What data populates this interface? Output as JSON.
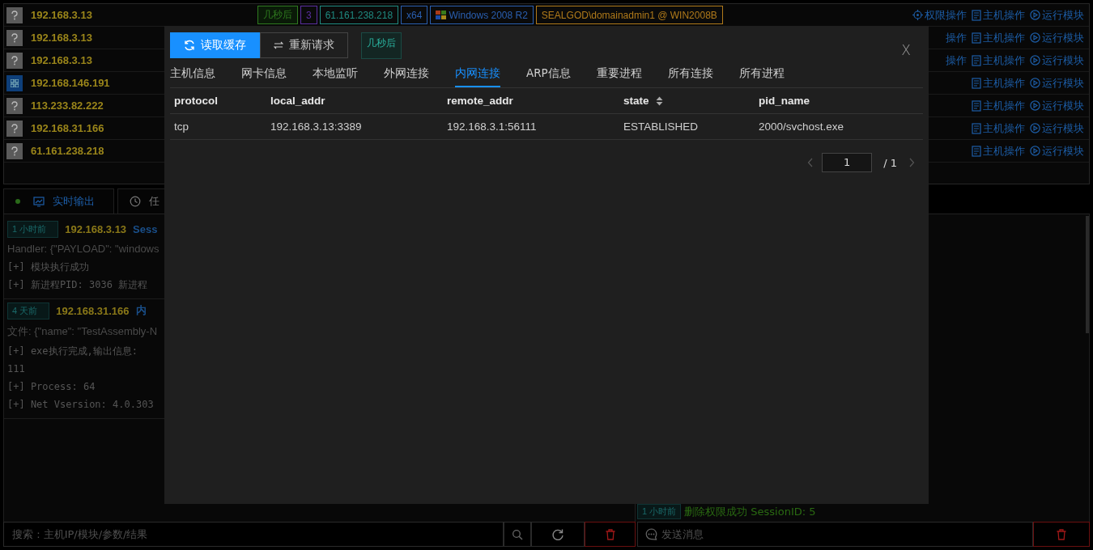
{
  "hosts": [
    {
      "kind": "unknown",
      "ip": "192.168.3.13",
      "tags": [
        {
          "text": "几秒后",
          "color": "#2f7a1f",
          "kind": "plain"
        },
        {
          "text": "3",
          "color": "#5a2fa0",
          "kind": "plain"
        },
        {
          "text": "61.161.238.218",
          "color": "#1f8a80",
          "kind": "plain"
        },
        {
          "text": "x64",
          "color": "#2a5fb0",
          "kind": "plain"
        },
        {
          "text": "Windows 2008 R2",
          "color": "#2a5fb0",
          "kind": "os"
        },
        {
          "text": "SEALGOD\\domainadmin1 @ WIN2008B",
          "color": "#b07a1a",
          "kind": "plain"
        }
      ],
      "actions": [
        {
          "kind": "target",
          "label": "权限操作"
        },
        {
          "kind": "doc",
          "label": "主机操作"
        },
        {
          "kind": "play",
          "label": "运行模块"
        }
      ]
    },
    {
      "kind": "unknown",
      "ip": "192.168.3.13",
      "actions": [
        {
          "kind": "text",
          "label": "操作"
        },
        {
          "kind": "doc",
          "label": "主机操作"
        },
        {
          "kind": "play",
          "label": "运行模块"
        }
      ]
    },
    {
      "kind": "unknown",
      "ip": "192.168.3.13",
      "actions": [
        {
          "kind": "text",
          "label": "操作"
        },
        {
          "kind": "doc",
          "label": "主机操作"
        },
        {
          "kind": "play",
          "label": "运行模块"
        }
      ]
    },
    {
      "kind": "windows",
      "ip": "192.168.146.191",
      "actions": [
        {
          "kind": "doc",
          "label": "主机操作"
        },
        {
          "kind": "play",
          "label": "运行模块"
        }
      ]
    },
    {
      "kind": "unknown",
      "ip": "113.233.82.222",
      "actions": [
        {
          "kind": "doc",
          "label": "主机操作"
        },
        {
          "kind": "play",
          "label": "运行模块"
        }
      ]
    },
    {
      "kind": "unknown",
      "ip": "192.168.31.166",
      "actions": [
        {
          "kind": "doc",
          "label": "主机操作"
        },
        {
          "kind": "play",
          "label": "运行模块"
        }
      ]
    },
    {
      "kind": "unknown",
      "ip": "61.161.238.218",
      "actions": [
        {
          "kind": "doc",
          "label": "主机操作"
        },
        {
          "kind": "play",
          "label": "运行模块"
        }
      ]
    }
  ],
  "output_panel": {
    "tabs": [
      {
        "label": "实时输出",
        "kind": "monitor",
        "selected": true
      },
      {
        "label": "任",
        "kind": "clock",
        "selected": false
      }
    ],
    "log": [
      {
        "time": "1 小时前",
        "ip": "192.168.3.13",
        "title": "Sess",
        "detail": "Handler: {\"PAYLOAD\": \"windows",
        "lines": [
          "[+] 模块执行成功",
          "[+] 新进程PID: 3036 新进程"
        ]
      },
      {
        "time": "4 天前",
        "ip": "192.168.31.166",
        "title": "内",
        "detail": "文件: {\"name\": \"TestAssembly-N",
        "lines": [
          "[+] exe执行完成,输出信息:",
          "111",
          "[+] Process: 64",
          "[+] Net Vsersion: 4.0.303"
        ]
      }
    ],
    "messages": [
      {
        "time": "1 小时前",
        "text": "删除权限成功 SessionID: 5"
      }
    ],
    "search": {
      "placeholder": "搜索 : 主机IP/模块/参数/结果"
    },
    "message_input": {
      "placeholder": "发送消息"
    }
  },
  "dialog": {
    "buttons": [
      {
        "label": "读取缓存",
        "kind": "sync",
        "selected": true
      },
      {
        "label": "重新请求",
        "kind": "swap",
        "selected": false
      }
    ],
    "badge": "几秒后",
    "close": "X",
    "tabs": [
      {
        "label": "主机信息",
        "selected": false
      },
      {
        "label": "网卡信息",
        "selected": false
      },
      {
        "label": "本地监听",
        "selected": false
      },
      {
        "label": "外网连接",
        "selected": false
      },
      {
        "label": "内网连接",
        "selected": true
      },
      {
        "label": "ARP信息",
        "selected": false
      },
      {
        "label": "重要进程",
        "selected": false
      },
      {
        "label": "所有连接",
        "selected": false
      },
      {
        "label": "所有进程",
        "selected": false
      }
    ],
    "table": {
      "columns": [
        {
          "label": "protocol",
          "sortable": false
        },
        {
          "label": "local_addr",
          "sortable": false
        },
        {
          "label": "remote_addr",
          "sortable": false
        },
        {
          "label": "state",
          "sortable": true
        },
        {
          "label": "pid_name",
          "sortable": false
        }
      ],
      "rows": [
        [
          "tcp",
          "192.168.3.13:3389",
          "192.168.3.1:56111",
          "ESTABLISHED",
          "2000/svchost.exe"
        ]
      ]
    },
    "pagination": {
      "page": "1",
      "total": "/ 1"
    }
  }
}
